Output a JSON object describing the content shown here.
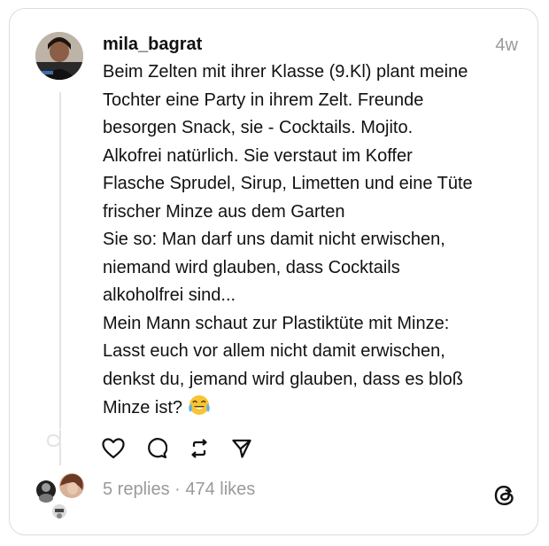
{
  "post": {
    "username": "mila_bagrat",
    "time_ago": "4w",
    "lines": [
      "Beim Zelten mit ihrer Klasse (9.Kl) plant meine",
      "Tochter eine Party in ihrem Zelt. Freunde",
      "besorgen Snack, sie - Cocktails. Mojito.",
      "Alkofrei natürlich. Sie verstaut im Koffer",
      "Flasche Sprudel, Sirup, Limetten und eine Tüte",
      "frischer Minze aus dem Garten",
      "Sie so: Man darf uns damit nicht erwischen,",
      "niemand wird glauben, dass Cocktails",
      "alkoholfrei sind...",
      "Mein Mann schaut zur Plastiktüte mit Minze:",
      "Lasst euch vor allem nicht damit erwischen,",
      "denkst du, jemand wird glauben, dass es bloß",
      "Minze ist?"
    ],
    "end_emoji": "face-with-tears-of-joy-icon"
  },
  "actions": {
    "like": "heart-icon",
    "comment": "comment-icon",
    "repost": "repost-icon",
    "share": "send-icon"
  },
  "footer": {
    "stats": "5 replies · 474 likes",
    "logo": "threads-logo-icon"
  },
  "colors": {
    "text": "#111111",
    "muted": "#9a9a9a",
    "border": "#dcdcdc"
  }
}
